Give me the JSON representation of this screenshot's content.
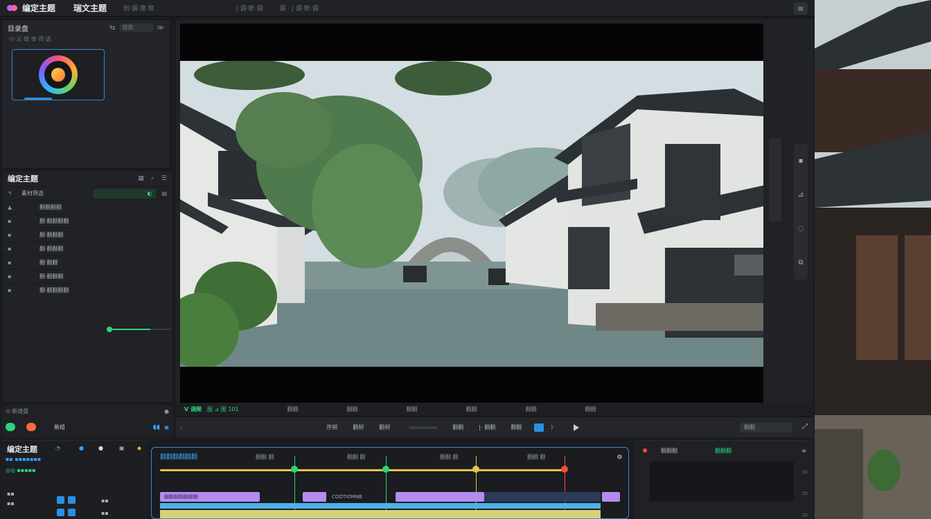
{
  "topbar": {
    "title": "编定主题",
    "title2": "瑞文主题",
    "small1": "创·调·建·筑",
    "small2": "| 调·新·调",
    "small3": "调 · | 调·新·调",
    "menu_icon": "≡"
  },
  "media_panel": {
    "title": "目录盘",
    "sub": "小·义·媒·体·筛·选",
    "search_placeholder": "搜索"
  },
  "project_panel": {
    "title": "编定主题",
    "filter_label": "素材筛选",
    "rows": [
      {
        "icon": "▲",
        "label": "翻翻翻翻"
      },
      {
        "icon": "▪",
        "label": "翻·翻翻翻翻"
      },
      {
        "icon": "▪",
        "label": "翻·翻翻翻"
      },
      {
        "icon": "▪",
        "label": "翻·翻翻翻"
      },
      {
        "icon": "▪",
        "label": "翻·翻翻"
      },
      {
        "icon": "▪",
        "label": "翻·翻翻翻"
      },
      {
        "icon": "▪",
        "label": "翻·翻翻翻翻"
      }
    ],
    "footer": "⊙ 新增盘"
  },
  "left_controls": {
    "label": "新组",
    "blue_icon": "◖◖"
  },
  "controls_top": {
    "green1": "V 调频",
    "green2": "图 ⊿ 图 101",
    "ticks": [
      "翻翻",
      "翻翻",
      "翻翻",
      "翻翻",
      "翻翻",
      "翻翻"
    ]
  },
  "controls_bar": {
    "buttons": [
      "序频",
      "翻频",
      "翻频"
    ],
    "buttons2": [
      "翻翻",
      "|- 翻翻",
      "翻翻"
    ],
    "right_label": "翻翻"
  },
  "timeline": {
    "title": "编定主题",
    "header": "翻翻翻翻翻翻",
    "markers": [
      "翻翻 翻",
      "翻翻 翻",
      "翻翻 翻",
      "翻翻 翻"
    ],
    "clip_label": "翻翻翻翻翻翻翻",
    "clip_mid": "COOTIOMNB"
  },
  "right_panel": {
    "label_a": "翻翻翻",
    "label_b": "翻翻翻"
  },
  "colors": {
    "accent_blue": "#2c8ee0",
    "accent_green": "#2ed37d",
    "accent_yellow": "#e6c24a",
    "clip_purple": "#b48cf0"
  }
}
